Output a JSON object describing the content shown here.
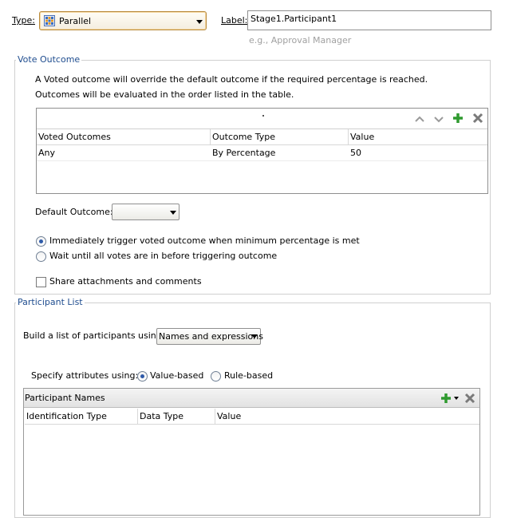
{
  "type_field": {
    "label": "Type:",
    "value": "Parallel",
    "icon": "parallel-grid-icon"
  },
  "label_field": {
    "label": "Label:",
    "value": "Stage1.Participant1",
    "hint": "e.g., Approval Manager"
  },
  "vote_outcome": {
    "title": "Vote Outcome",
    "description_line1": "A Voted outcome will override the default outcome if the required percentage is reached.",
    "description_line2": "Outcomes will be evaluated in the order listed in the table.",
    "toolbar_icons": [
      "move-up-icon",
      "move-down-icon",
      "add-icon",
      "delete-icon"
    ],
    "table": {
      "columns": [
        "Voted Outcomes",
        "Outcome Type",
        "Value"
      ],
      "rows": [
        {
          "outcome": "Any",
          "type": "By Percentage",
          "value": "50"
        }
      ]
    },
    "default_outcome_label": "Default Outcome:",
    "default_outcome_value": "",
    "radio_immediate": "Immediately trigger voted outcome when minimum percentage is met",
    "radio_wait": "Wait until all votes are in before triggering outcome",
    "selected_radio": "immediate",
    "share_checkbox": "Share attachments and comments",
    "share_checked": false
  },
  "participant_list": {
    "title": "Participant List",
    "build_label": "Build a list of participants using:",
    "build_value": "Names and expressions",
    "specify_label": "Specify attributes using:",
    "option_value": "Value-based",
    "option_rule": "Rule-based",
    "selected_option": "value",
    "panel_title": "Participant Names",
    "table_columns": [
      "Identification Type",
      "Data Type",
      "Value"
    ]
  },
  "colors": {
    "group_title": "#1f4d8f",
    "add_icon": "#2f9a2f",
    "hint_text": "#a0a0a0"
  }
}
